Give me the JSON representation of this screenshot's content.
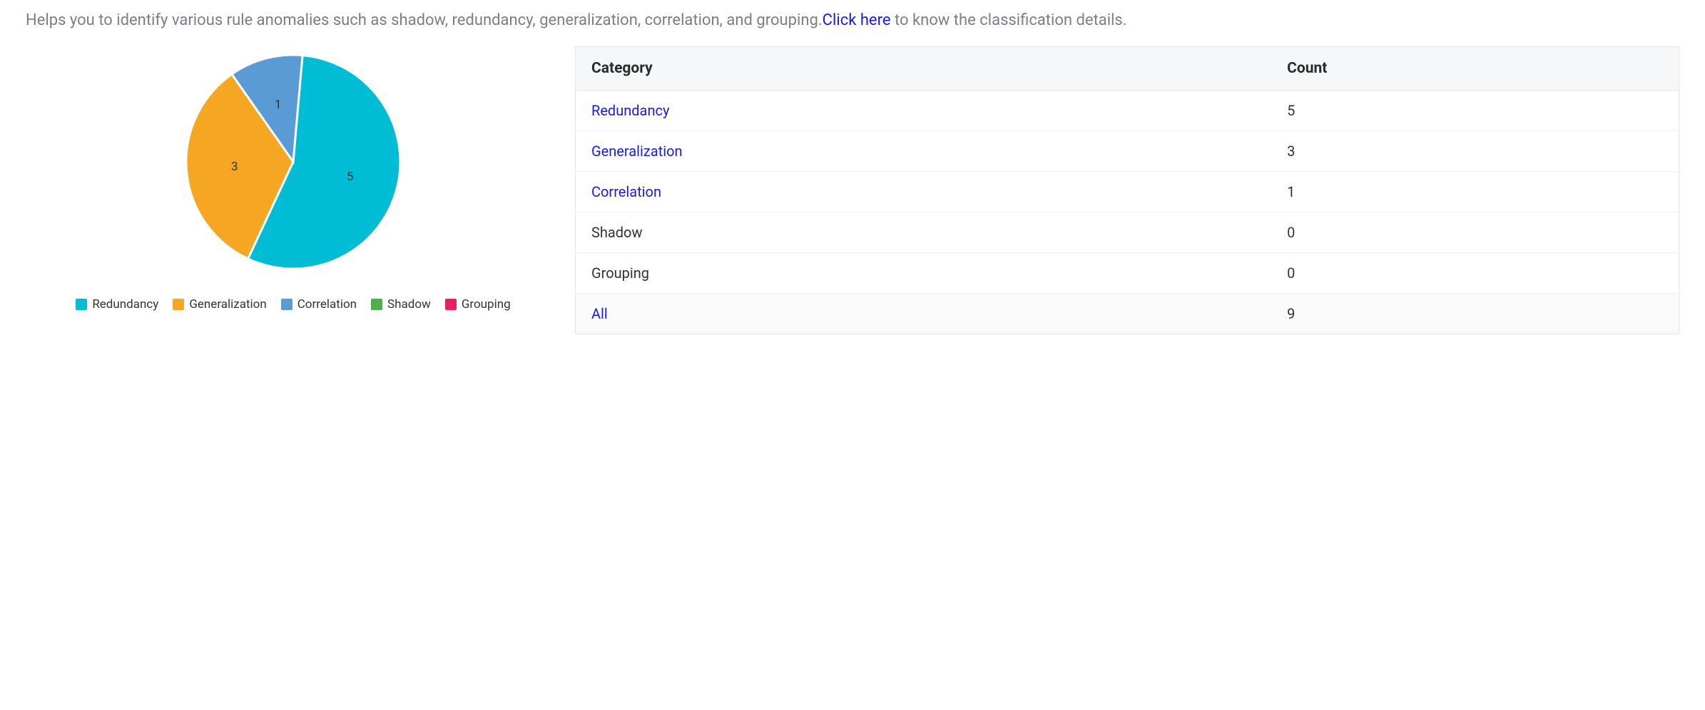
{
  "description": {
    "text_prefix": "Helps you to identify various rule anomalies such as shadow, redundancy, generalization, correlation, and grouping.",
    "link_text": "Click here",
    "text_suffix": " to know the classification details."
  },
  "chart_data": {
    "type": "pie",
    "title": "",
    "series": [
      {
        "name": "Redundancy",
        "value": 5,
        "color": "#00bcd4"
      },
      {
        "name": "Generalization",
        "value": 3,
        "color": "#f5a623"
      },
      {
        "name": "Correlation",
        "value": 1,
        "color": "#5b9bd5"
      },
      {
        "name": "Shadow",
        "value": 0,
        "color": "#4caf50"
      },
      {
        "name": "Grouping",
        "value": 0,
        "color": "#e91e63"
      }
    ],
    "legend_position": "bottom"
  },
  "table": {
    "headers": {
      "category": "Category",
      "count": "Count"
    },
    "rows": [
      {
        "label": "Redundancy",
        "count": "5",
        "is_link": true
      },
      {
        "label": "Generalization",
        "count": "3",
        "is_link": true
      },
      {
        "label": "Correlation",
        "count": "1",
        "is_link": true
      },
      {
        "label": "Shadow",
        "count": "0",
        "is_link": false
      },
      {
        "label": "Grouping",
        "count": "0",
        "is_link": false
      }
    ],
    "footer": {
      "label": "All",
      "count": "9",
      "is_link": true
    }
  }
}
